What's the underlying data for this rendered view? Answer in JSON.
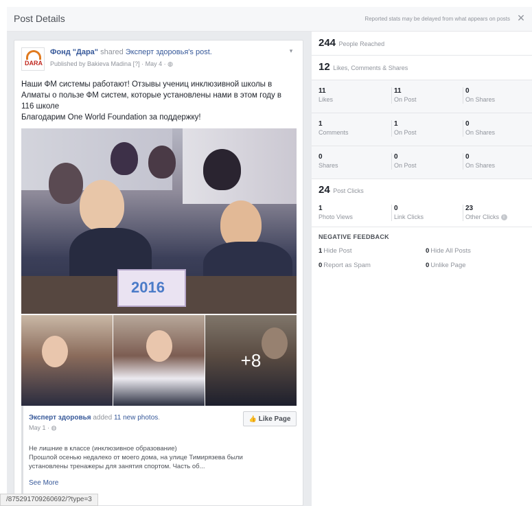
{
  "header": {
    "title": "Post Details",
    "note": "Reported stats may be delayed from what appears on posts",
    "close_glyph": "✕"
  },
  "post": {
    "page_name": "Фонд \"Дара\"",
    "shared_word": "shared",
    "source_name": "Эксперт здоровья",
    "source_suffix": "'s",
    "post_word": "post.",
    "published_by": "Published by Bakieva Madina [?] · May 4 · ",
    "globe_glyph": "◍",
    "avatar_text": "DARA",
    "text_line1": "Наши ФМ системы работают! Отзывы учениц инклюзивной школы в Алматы о пользе ФМ систем, которые установлены нами в этом году в 116 школе",
    "text_line2": "Благодарим One World Foundation за поддержку!",
    "year_label": "2016",
    "more_photos": "+8"
  },
  "shared": {
    "author": "Эксперт здоровья",
    "added": " added ",
    "photos_link": "11 new photos",
    "period": ".",
    "date": "May 1 · ",
    "like_button": "Like Page",
    "text_line1": "Не лишние в классе (инклюзивное образование)",
    "text_line2": "Прошлой осенью недалеко от моего дома, на улице Тимирязева были установлены тренажеры для занятия спортом. Часть об...",
    "see_more": "See More"
  },
  "status_url": "/875291709260692/?type=3",
  "stats": {
    "reached_num": "244",
    "reached_label": "People Reached",
    "engagement_num": "12",
    "engagement_label": "Likes, Comments & Shares",
    "rows": [
      {
        "total": "11",
        "total_label": "Likes",
        "post": "11",
        "post_label": "On Post",
        "shares": "0",
        "shares_label": "On Shares"
      },
      {
        "total": "1",
        "total_label": "Comments",
        "post": "1",
        "post_label": "On Post",
        "shares": "0",
        "shares_label": "On Shares"
      },
      {
        "total": "0",
        "total_label": "Shares",
        "post": "0",
        "post_label": "On Post",
        "shares": "0",
        "shares_label": "On Shares"
      }
    ],
    "clicks_num": "24",
    "clicks_label": "Post Clicks",
    "clicks": [
      {
        "num": "1",
        "label": "Photo Views"
      },
      {
        "num": "0",
        "label": "Link Clicks"
      },
      {
        "num": "23",
        "label": "Other Clicks"
      }
    ],
    "info_glyph": "i"
  },
  "negative": {
    "title": "NEGATIVE FEEDBACK",
    "items": [
      {
        "num": "1",
        "label": "Hide Post"
      },
      {
        "num": "0",
        "label": "Hide All Posts"
      },
      {
        "num": "0",
        "label": "Report as Spam"
      },
      {
        "num": "0",
        "label": "Unlike Page"
      }
    ]
  },
  "colors": {
    "link": "#365899",
    "muted": "#90949c",
    "band": "#f6f7f9",
    "background": "#e9ebee"
  }
}
